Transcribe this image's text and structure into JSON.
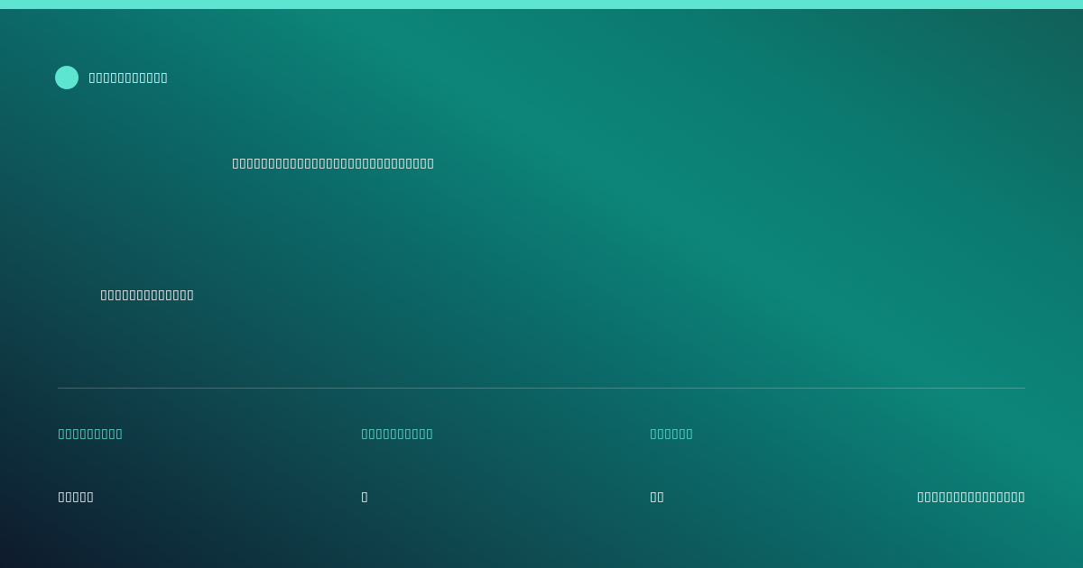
{
  "colors": {
    "accent": "#5de5d2",
    "background_dark": "#0e1a2c",
    "background_teal": "#0d8679",
    "text": "#ffffff"
  },
  "brand": {
    "icon": "circle-logo-icon",
    "name": "▯▯▯▯▯▯▯▯▯▯▯"
  },
  "headline": "▯▯▯▯▯▯▯▯▯▯▯▯▯▯▯▯▯▯▯▯▯▯▯▯▯▯▯▯",
  "subline": "▯▯▯▯▯▯▯▯▯▯▯▯▯",
  "stats": [
    {
      "label": "▯▯▯▯▯▯▯▯▯",
      "value": "▯▯▯▯▯"
    },
    {
      "label": "▯▯▯▯▯▯▯▯▯▯",
      "value": "▯"
    },
    {
      "label": "▯▯▯▯▯▯",
      "value": "▯▯"
    }
  ],
  "footer_note": "▯▯▯▯▯▯▯▯▯▯▯▯▯▯▯"
}
